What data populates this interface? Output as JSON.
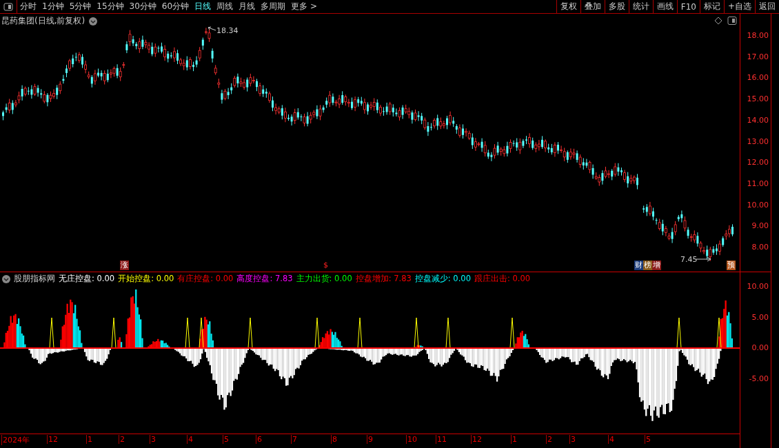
{
  "toolbar": {
    "periods": [
      {
        "label": "分时",
        "selected": false
      },
      {
        "label": "1分钟",
        "selected": false
      },
      {
        "label": "5分钟",
        "selected": false
      },
      {
        "label": "15分钟",
        "selected": false
      },
      {
        "label": "30分钟",
        "selected": false
      },
      {
        "label": "60分钟",
        "selected": false
      },
      {
        "label": "日线",
        "selected": true
      },
      {
        "label": "周线",
        "selected": false
      },
      {
        "label": "月线",
        "selected": false
      },
      {
        "label": "多周期",
        "selected": false
      }
    ],
    "more": "更多 >",
    "buttons": [
      "复权",
      "叠加",
      "多股",
      "统计",
      "画线",
      "F10",
      "标记",
      "+自选",
      "返回"
    ]
  },
  "price_chart": {
    "title": "昆药集团(日线,前复权)",
    "high_label": "18.34",
    "low_label": "7.45",
    "y_axis": [
      "18.00",
      "17.00",
      "16.00",
      "15.00",
      "14.00",
      "13.00",
      "12.00",
      "11.00",
      "10.00",
      "9.00",
      "8.00"
    ],
    "markers": [
      {
        "text": "涨",
        "color": "#8b1a1a"
      },
      {
        "text": "$",
        "color": "#000000"
      },
      {
        "text": "财",
        "color": "#1a3a7a"
      },
      {
        "text": "榜",
        "color": "#8a5a1a"
      },
      {
        "text": "增",
        "color": "#8b1a1a"
      },
      {
        "text": "预",
        "color": "#b4541a"
      }
    ]
  },
  "indicator": {
    "name": "股朋指标网",
    "legend": [
      {
        "label": "无庄控盘:",
        "value": "0.00",
        "color": "#ffffff"
      },
      {
        "label": "开始控盘:",
        "value": "0.00",
        "color": "#ffff00"
      },
      {
        "label": "有庄控盘:",
        "value": "0.00",
        "color": "#ff0000"
      },
      {
        "label": "高度控盘:",
        "value": "7.83",
        "color": "#ff00ff"
      },
      {
        "label": "主力出货:",
        "value": "0.00",
        "color": "#00ff00"
      },
      {
        "label": "控盘增加:",
        "value": "7.83",
        "color": "#ff0000"
      },
      {
        "label": "控盘减少:",
        "value": "0.00",
        "color": "#00ffff"
      },
      {
        "label": "跟庄出击:",
        "value": "0.00",
        "color": "#ff0000"
      }
    ],
    "y_axis": [
      "10.00",
      "5.00",
      "0.00",
      "-5.00"
    ]
  },
  "date_axis": [
    "2024年",
    "12",
    "1",
    "2",
    "3",
    "4",
    "5",
    "6",
    "7",
    "8",
    "9",
    "10",
    "11",
    "12",
    "1",
    "2",
    "3",
    "4",
    "5"
  ]
}
